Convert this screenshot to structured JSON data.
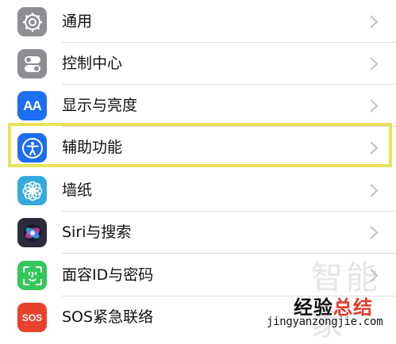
{
  "settings": {
    "items": [
      {
        "label": "通用",
        "icon": "gear-icon",
        "color": "#8e8e93"
      },
      {
        "label": "控制中心",
        "icon": "toggles-icon",
        "color": "#8e8e93"
      },
      {
        "label": "显示与亮度",
        "icon": "text-size-icon",
        "color": "#1c6ef2"
      },
      {
        "label": "辅助功能",
        "icon": "accessibility-icon",
        "color": "#1c6ef2"
      },
      {
        "label": "墙纸",
        "icon": "flower-icon",
        "color": "#35aadc"
      },
      {
        "label": "Siri与搜索",
        "icon": "siri-icon",
        "color": "#2b2b3c"
      },
      {
        "label": "面容ID与密码",
        "icon": "face-id-icon",
        "color": "#34c759"
      },
      {
        "label": "SOS紧急联络",
        "icon": "sos-icon",
        "color": "#e8412e"
      }
    ],
    "icon_text": {
      "display": "AA",
      "sos": "SOS"
    },
    "highlight_color": "#e9e35a"
  },
  "watermark": {
    "logo": "智能家",
    "main_part1": "经验",
    "main_part2": "总结",
    "url": "jingyanzongjie.com"
  }
}
